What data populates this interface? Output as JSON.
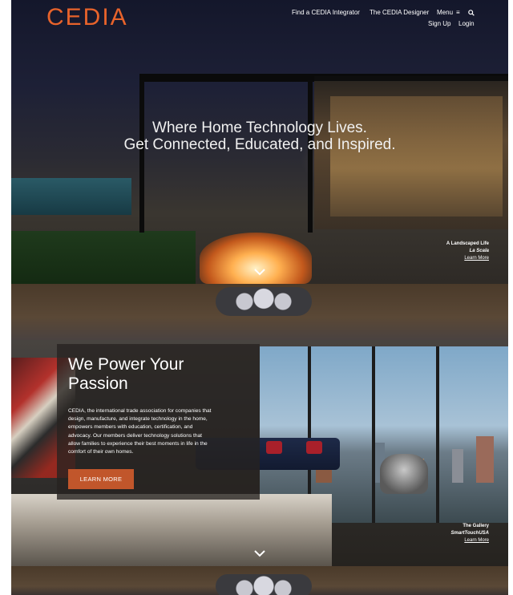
{
  "header": {
    "logo_text": "CEDIA",
    "nav_find": "Find a CEDIA Integrator",
    "nav_designer": "The CEDIA Designer",
    "nav_menu": "Menu",
    "menu_icon": "hamburger-icon",
    "search_icon": "search-icon",
    "nav_signup": "Sign Up",
    "nav_login": "Login"
  },
  "hero": {
    "line1": "Where Home Technology Lives.",
    "line2": "Get Connected, Educated, and Inspired.",
    "caption_title": "A Landscaped Life",
    "caption_subtitle": "La Scala",
    "caption_link": "Learn More",
    "scroll_icon": "chevron-down-icon"
  },
  "passion": {
    "title_line1": "We Power Your",
    "title_line2": "Passion",
    "body_line1": "CEDIA, the international trade association for companies that",
    "body_line2": "design, manufacture, and integrate technology in the home,",
    "body_line3": "empowers members with education, certification, and",
    "body_line4": "advocacy. Our members deliver technology solutions that",
    "body_line5": "allow families to experience their best moments in life in the",
    "body_line6": "comfort of their own homes.",
    "button_label": "LEARN MORE",
    "caption_title": "The Gallery",
    "caption_subtitle": "SmartTouchUSA",
    "caption_link": "Learn More",
    "scroll_icon": "chevron-down-icon"
  },
  "colors": {
    "accent": "#e8632b",
    "button": "#c1562b",
    "panel": "#262220"
  }
}
